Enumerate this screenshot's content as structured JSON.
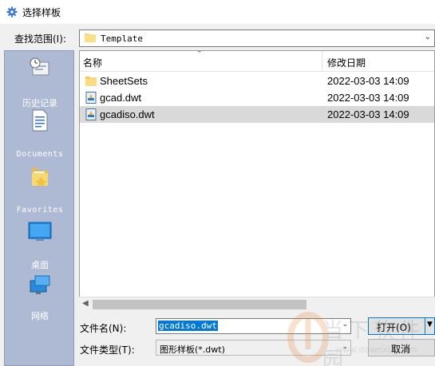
{
  "window": {
    "title": "选择样板"
  },
  "lookin": {
    "label": "查找范围(I):",
    "value": "Template"
  },
  "places": [
    {
      "label": "历史记录",
      "icon": "history-icon"
    },
    {
      "label": "",
      "icon": "document-icon"
    },
    {
      "label": "Documents",
      "icon": "documents-folder-icon"
    },
    {
      "label": "Favorites",
      "icon": "favorites-icon"
    },
    {
      "label": "桌面",
      "icon": "desktop-icon"
    },
    {
      "label": "网络",
      "icon": "network-icon"
    }
  ],
  "filelist": {
    "columns": {
      "name": "名称",
      "date": "修改日期"
    },
    "rows": [
      {
        "name": "SheetSets",
        "date": "2022-03-03 14:09",
        "type": "folder",
        "selected": false
      },
      {
        "name": "gcad.dwt",
        "date": "2022-03-03 14:09",
        "type": "dwt",
        "selected": false
      },
      {
        "name": "gcadiso.dwt",
        "date": "2022-03-03 14:09",
        "type": "dwt",
        "selected": true
      }
    ]
  },
  "filename": {
    "label": "文件名(N):",
    "value": "gcadiso.dwt"
  },
  "filetype": {
    "label": "文件类型(T):",
    "value": "图形样板(*.dwt)"
  },
  "buttons": {
    "open": "打开(O)",
    "cancel": "取消"
  },
  "watermark": {
    "text": "当下软件园",
    "url": "www.downxia.com"
  },
  "colors": {
    "accent": "#0078d7",
    "places_bg": "#aebad3",
    "selected_row": "#d9d9d9"
  }
}
